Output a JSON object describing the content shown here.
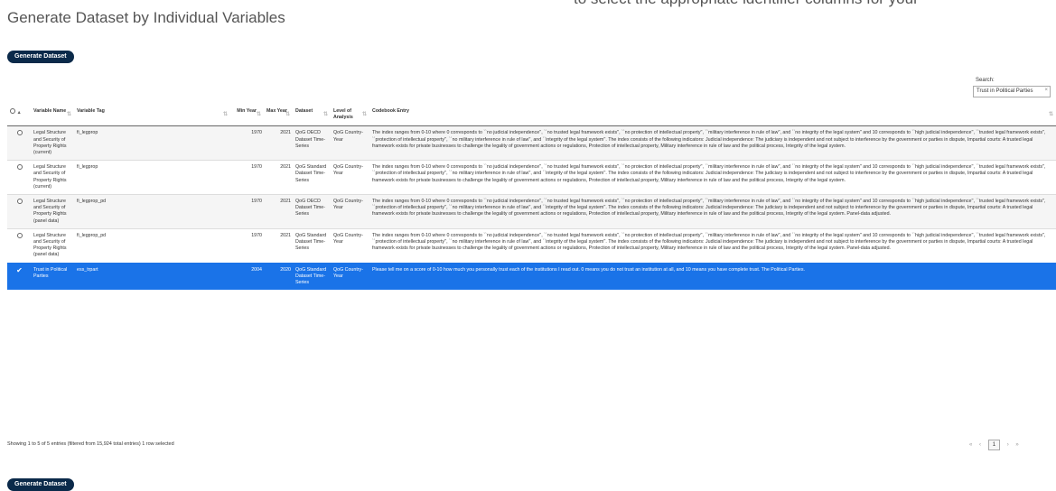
{
  "page_title": "Generate Dataset by Individual Variables",
  "top_right_note": "to select the appropriate identifier columns for your",
  "generate_button_label": "Generate Dataset",
  "search": {
    "label": "Search:",
    "value": "Trust in Political Parties",
    "clear_icon": "×"
  },
  "columns": {
    "select": "",
    "name": "Variable Name",
    "tag": "Variable Tag",
    "min": "Min Year",
    "max": "Max Year",
    "dataset": "Dataset",
    "level": "Level of Analysis",
    "codebook": "Codebook Entry"
  },
  "rows": [
    {
      "name": "Legal Structure and Security of Property Rights (current)",
      "tag": "fi_legprop",
      "min": "1970",
      "max": "2021",
      "dataset": "QoG OECD Dataset Time-Series",
      "level": "QoG Country-Year",
      "codebook": "The index ranges from 0-10 where 0 corresponds to ``no judicial independence'', ``no trusted legal framework exists'', ``no protection of intellectual property'', ``military interference in rule of law'', and ``no integrity of the legal system'' and 10 corresponds to ``high judicial independence'', ``trusted legal framework exists'', ``protection of intellectual property'', ``no military interference in rule of law'', and ``integrity of the legal system''. The index consists of the following indicators: Judicial independence: The judiciary is independent and not subject to interference by the government or parties in dispute, Impartial courts: A trusted legal framework exists for private businesses to challenge the legality of government actions or regulations, Protection of intellectual property, Military interference in rule of law and the political process, Integrity of the legal system."
    },
    {
      "name": "Legal Structure and Security of Property Rights (current)",
      "tag": "fi_legprop",
      "min": "1970",
      "max": "2021",
      "dataset": "QoG Standard Dataset Time-Series",
      "level": "QoG Country-Year",
      "codebook": "The index ranges from 0-10 where 0 corresponds to ``no judicial independence'', ``no trusted legal framework exists'', ``no protection of intellectual property'', ``military interference in rule of law'', and ``no integrity of the legal system'' and 10 corresponds to ``high judicial independence'', ``trusted legal framework exists'', ``protection of intellectual property'', ``no military interference in rule of law'', and ``integrity of the legal system''. The index consists of the following indicators: Judicial independence: The judiciary is independent and not subject to interference by the government or parties in dispute, Impartial courts: A trusted legal framework exists for private businesses to challenge the legality of government actions or regulations, Protection of intellectual property, Military interference in rule of law and the political process, Integrity of the legal system."
    },
    {
      "name": "Legal Structure and Security of Property Rights (panel data)",
      "tag": "fi_legprop_pd",
      "min": "1970",
      "max": "2021",
      "dataset": "QoG OECD Dataset Time-Series",
      "level": "QoG Country-Year",
      "codebook": "The index ranges from 0-10 where 0 corresponds to ``no judicial independence'', ``no trusted legal framework exists'', ``no protection of intellectual property'', ``military interference in rule of law'', and ``no integrity of the legal system'' and 10 corresponds to ``high judicial independence'', ``trusted legal framework exists'', ``protection of intellectual property'', ``no military interference in rule of law'', and ``integrity of the legal system''. The index consists of the following indicators: Judicial independence: The judiciary is independent and not subject to interference by the government or parties in dispute, Impartial courts: A trusted legal framework exists for private businesses to challenge the legality of government actions or regulations, Protection of intellectual property, Military interference in rule of law and the political process, Integrity of the legal system. Panel-data adjusted."
    },
    {
      "name": "Legal Structure and Security of Property Rights (panel data)",
      "tag": "fi_legprop_pd",
      "min": "1970",
      "max": "2021",
      "dataset": "QoG Standard Dataset Time-Series",
      "level": "QoG Country-Year",
      "codebook": "The index ranges from 0-10 where 0 corresponds to ``no judicial independence'', ``no trusted legal framework exists'', ``no protection of intellectual property'', ``military interference in rule of law'', and ``no integrity of the legal system'' and 10 corresponds to ``high judicial independence'', ``trusted legal framework exists'', ``protection of intellectual property'', ``no military interference in rule of law'', and ``integrity of the legal system''. The index consists of the following indicators: Judicial independence: The judiciary is independent and not subject to interference by the government or parties in dispute, Impartial courts: A trusted legal framework exists for private businesses to challenge the legality of government actions or regulations, Protection of intellectual property, Military interference in rule of law and the political process, Integrity of the legal system. Panel-data adjusted."
    },
    {
      "name": "Trust in Political Parties",
      "tag": "ess_trpart",
      "min": "2004",
      "max": "2020",
      "dataset": "QoG Standard Dataset Time-Series",
      "level": "QoG Country-Year",
      "codebook": "Please tell me on a score of 0-10 how much you personally trust each of the institutions I read out. 0 means you do not trust an institution at all, and 10 means you have complete trust. The Political Parties."
    }
  ],
  "selected_row_index": 4,
  "footer_info": "Showing 1 to 5 of 5 entries (filtered from 15,924 total entries)   1 row selected",
  "pagination": {
    "first": "«",
    "prev": "‹",
    "current": "1",
    "next": "›",
    "last": "»"
  },
  "colors": {
    "selected_row": "#1a73e8",
    "button": "#0b2a4a"
  }
}
